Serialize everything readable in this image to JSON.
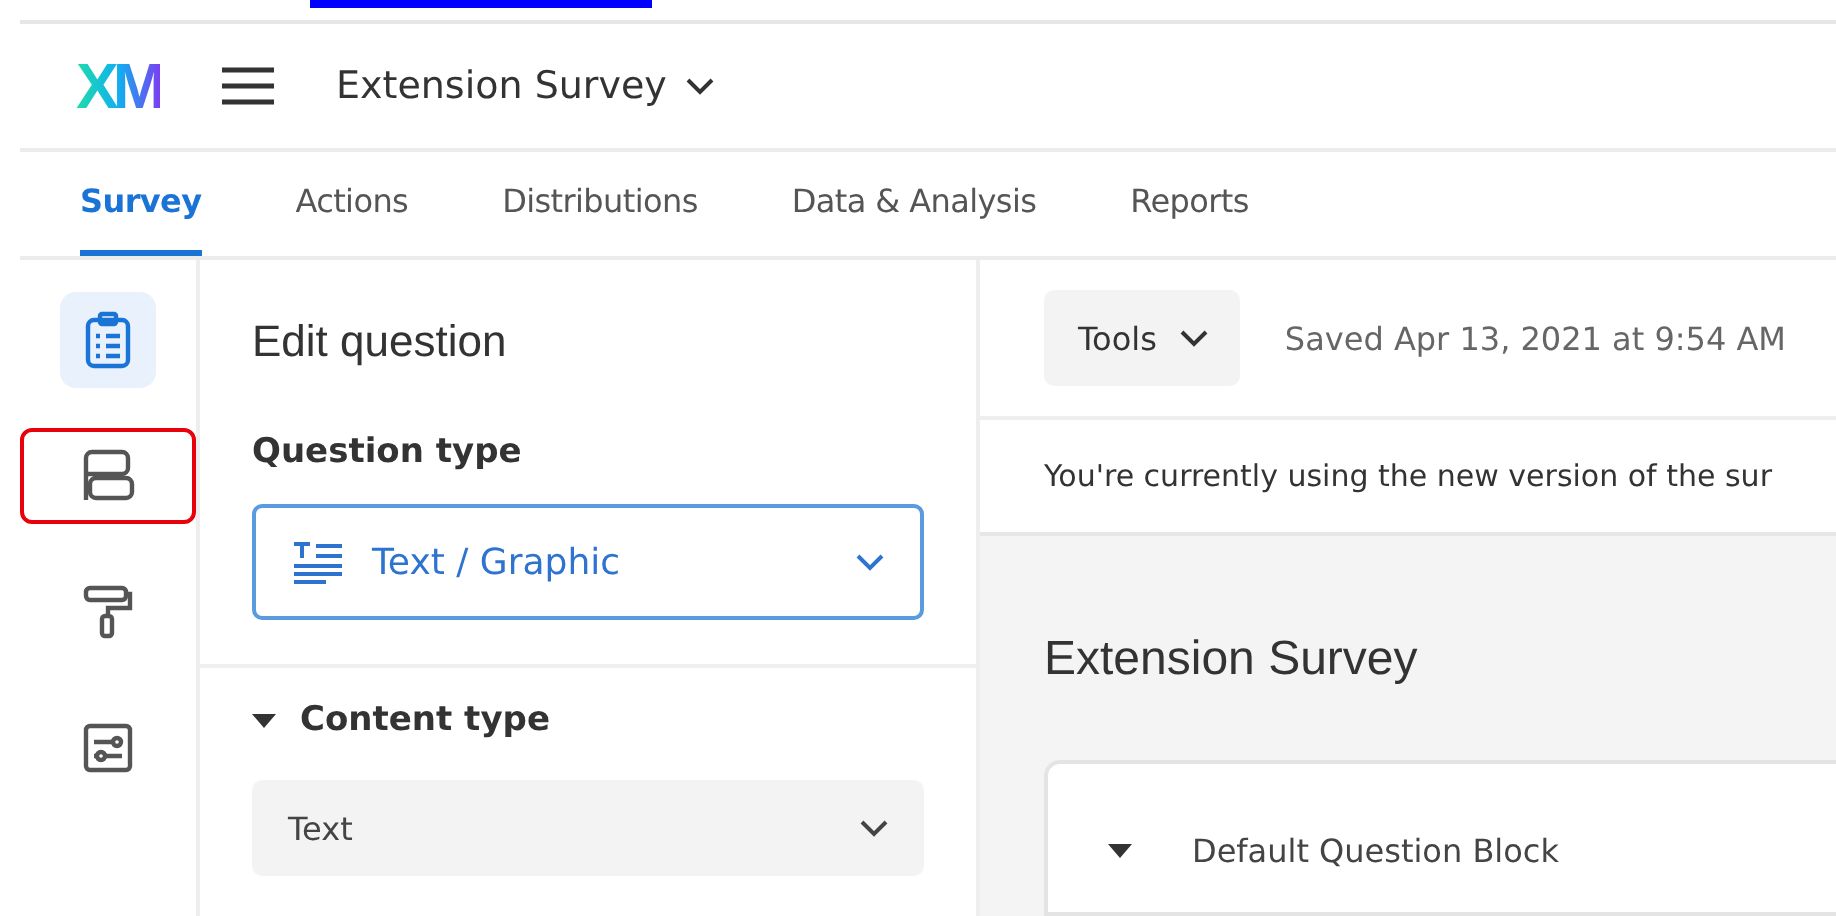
{
  "header": {
    "logo": "XM",
    "project": "Extension Survey"
  },
  "tabs": [
    {
      "label": "Survey",
      "selected": true
    },
    {
      "label": "Actions",
      "selected": false
    },
    {
      "label": "Distributions",
      "selected": false
    },
    {
      "label": "Data & Analysis",
      "selected": false
    },
    {
      "label": "Reports",
      "selected": false
    }
  ],
  "rail": [
    {
      "kind": "survey",
      "selected": true,
      "highlighted": false
    },
    {
      "kind": "blocks",
      "selected": false,
      "highlighted": true
    },
    {
      "kind": "look",
      "selected": false,
      "highlighted": false
    },
    {
      "kind": "options",
      "selected": false,
      "highlighted": false
    }
  ],
  "editor": {
    "title": "Edit question",
    "question_type_label": "Question type",
    "question_type": "Text / Graphic",
    "content_section": {
      "label": "Content type",
      "expanded": true,
      "value": "Text"
    }
  },
  "toolbar": {
    "tools": "Tools",
    "saved": "Saved Apr 13, 2021 at 9:54 AM"
  },
  "notice": "You're currently using the new version of the sur",
  "survey": {
    "title": "Extension Survey",
    "block": {
      "name": "Default Question Block",
      "expanded": true
    }
  }
}
